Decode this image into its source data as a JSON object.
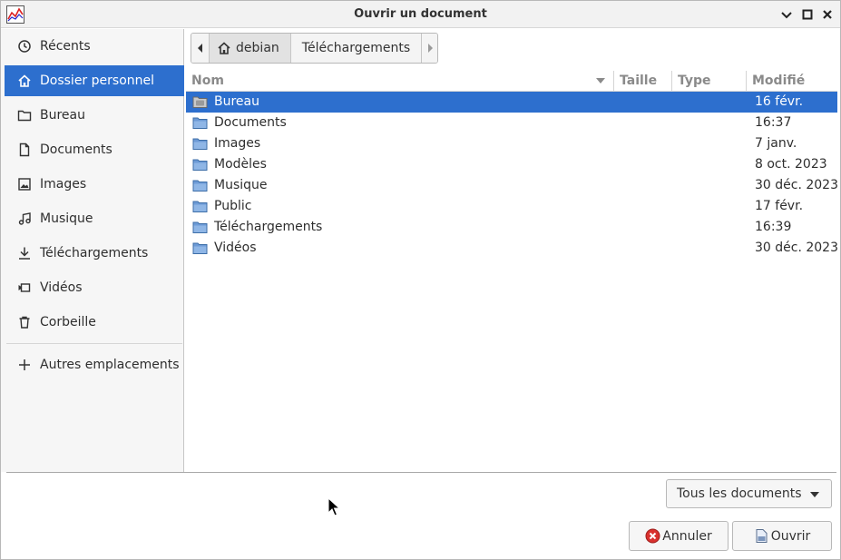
{
  "window": {
    "title": "Ouvrir un document"
  },
  "sidebar": {
    "items": [
      {
        "label": "Récents",
        "icon": "clock-icon"
      },
      {
        "label": "Dossier personnel",
        "icon": "home-icon"
      },
      {
        "label": "Bureau",
        "icon": "folder-icon"
      },
      {
        "label": "Documents",
        "icon": "document-icon"
      },
      {
        "label": "Images",
        "icon": "image-icon"
      },
      {
        "label": "Musique",
        "icon": "music-icon"
      },
      {
        "label": "Téléchargements",
        "icon": "download-icon"
      },
      {
        "label": "Vidéos",
        "icon": "video-icon"
      },
      {
        "label": "Corbeille",
        "icon": "trash-icon"
      },
      {
        "label": "Autres emplacements",
        "icon": "plus-icon"
      }
    ],
    "active_index": 1
  },
  "pathbar": {
    "segments": [
      "debian",
      "Téléchargements"
    ]
  },
  "columns": {
    "name": "Nom",
    "size": "Taille",
    "type": "Type",
    "modified": "Modifié"
  },
  "files": [
    {
      "name": "Bureau",
      "modified": "16 févr.",
      "selected": true
    },
    {
      "name": "Documents",
      "modified": "16:37"
    },
    {
      "name": "Images",
      "modified": "7 janv."
    },
    {
      "name": "Modèles",
      "modified": "8 oct. 2023"
    },
    {
      "name": "Musique",
      "modified": "30 déc. 2023"
    },
    {
      "name": "Public",
      "modified": "17 févr."
    },
    {
      "name": "Téléchargements",
      "modified": "16:39"
    },
    {
      "name": "Vidéos",
      "modified": "30 déc. 2023"
    }
  ],
  "filter": {
    "selected": "Tous les documents"
  },
  "buttons": {
    "cancel": "Annuler",
    "open": "Ouvrir"
  },
  "colors": {
    "accent": "#2d6fce",
    "folder": "#6d9bd6"
  }
}
